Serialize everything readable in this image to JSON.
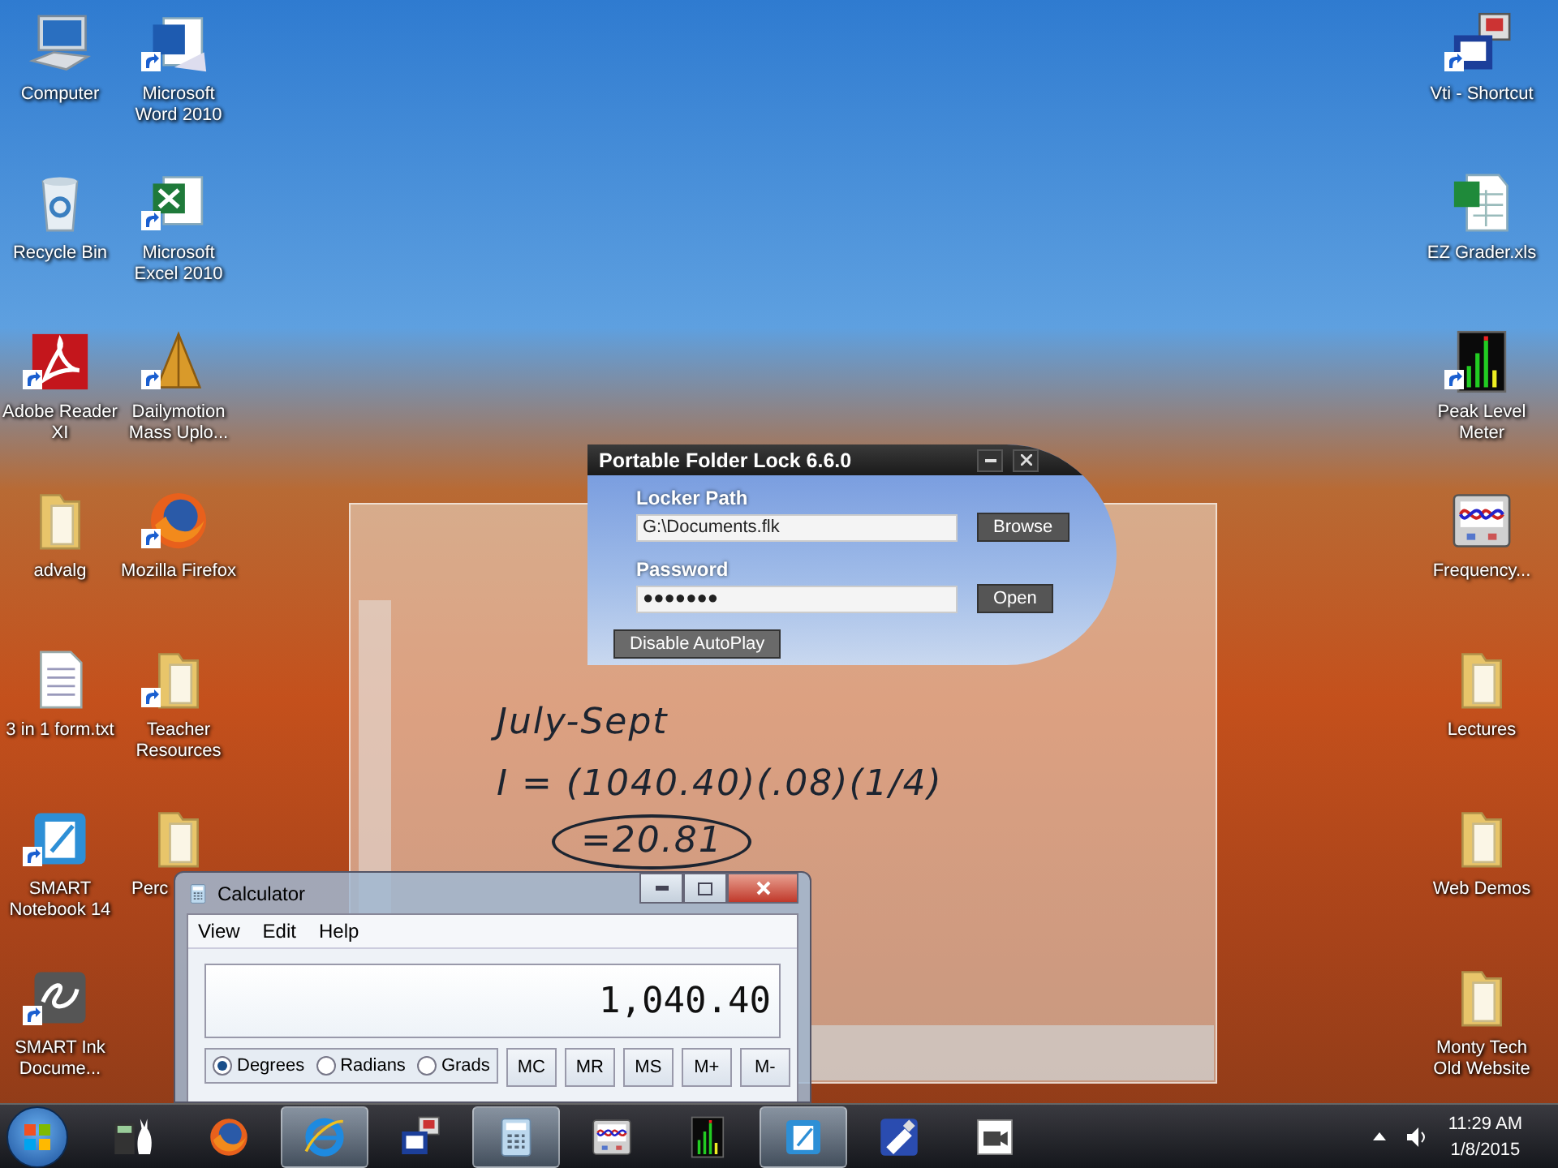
{
  "desktop": {
    "left_columns": [
      [
        {
          "label": "Computer",
          "kind": "computer",
          "shortcut": false,
          "clipped": false
        },
        {
          "label": "Recycle Bin",
          "kind": "recycle",
          "shortcut": false,
          "clipped": false
        },
        {
          "label": "Adobe Reader XI",
          "kind": "pdf",
          "shortcut": true,
          "clipped": false
        },
        {
          "label": "advalg",
          "kind": "folder",
          "shortcut": false,
          "clipped": false
        },
        {
          "label": "3 in 1 form.txt",
          "kind": "textfile",
          "shortcut": false,
          "clipped": false
        },
        {
          "label": "SMART Notebook 14",
          "kind": "smart",
          "shortcut": true,
          "clipped": false
        },
        {
          "label": "SMART Ink Docume...",
          "kind": "ink",
          "shortcut": true,
          "clipped": false
        }
      ],
      [
        {
          "label": "Microsoft Word 2010",
          "kind": "word",
          "shortcut": true,
          "clipped": false
        },
        {
          "label": "Microsoft Excel 2010",
          "kind": "excel",
          "shortcut": true,
          "clipped": false
        },
        {
          "label": "Dailymotion Mass Uplo...",
          "kind": "cone",
          "shortcut": true,
          "clipped": false
        },
        {
          "label": "Mozilla Firefox",
          "kind": "firefox",
          "shortcut": true,
          "clipped": false
        },
        {
          "label": "Teacher Resources",
          "kind": "folder",
          "shortcut": true,
          "clipped": false
        },
        {
          "label": "Perc",
          "kind": "folder",
          "shortcut": false,
          "clipped": true
        }
      ]
    ],
    "right_column": [
      {
        "label": "Vti - Shortcut",
        "kind": "vti",
        "shortcut": true,
        "clipped": false
      },
      {
        "label": "EZ Grader.xls",
        "kind": "sheet",
        "shortcut": false,
        "clipped": false
      },
      {
        "label": "Peak Level Meter",
        "kind": "meter",
        "shortcut": true,
        "clipped": false
      },
      {
        "label": "Frequency...",
        "kind": "wave",
        "shortcut": false,
        "clipped": false
      },
      {
        "label": "Lectures",
        "kind": "folder",
        "shortcut": false,
        "clipped": false
      },
      {
        "label": "Web Demos",
        "kind": "folder",
        "shortcut": false,
        "clipped": false
      },
      {
        "label": "Monty Tech Old Website",
        "kind": "folder",
        "shortcut": false,
        "clipped": false
      }
    ]
  },
  "notebook": {
    "lines": [
      {
        "text": "July-Sept",
        "circled": false
      },
      {
        "text": "I = (1040.40)(.08)(1/4)",
        "circled": false
      },
      {
        "text": "=20.81",
        "circled": true
      }
    ]
  },
  "folder_lock": {
    "title": "Portable Folder Lock 6.6.0",
    "path_label": "Locker Path",
    "path_value": "G:\\Documents.flk",
    "browse": "Browse",
    "password_label": "Password",
    "password_mask": "●●●●●●●",
    "open": "Open",
    "autoplay": "Disable AutoPlay"
  },
  "calculator": {
    "title": "Calculator",
    "menu": [
      "View",
      "Edit",
      "Help"
    ],
    "display": "1,040.40",
    "angle_units": [
      {
        "label": "Degrees",
        "selected": true
      },
      {
        "label": "Radians",
        "selected": false
      },
      {
        "label": "Grads",
        "selected": false
      }
    ],
    "memory_buttons": [
      "MC",
      "MR",
      "MS",
      "M+",
      "M-"
    ]
  },
  "taskbar": {
    "items": [
      {
        "kind": "calcrabbit",
        "running": false
      },
      {
        "kind": "firefox",
        "running": false
      },
      {
        "kind": "ie",
        "running": true
      },
      {
        "kind": "vti",
        "running": false
      },
      {
        "kind": "calculator",
        "running": true
      },
      {
        "kind": "wave",
        "running": false
      },
      {
        "kind": "meter",
        "running": false
      },
      {
        "kind": "smart",
        "running": true
      },
      {
        "kind": "usb",
        "running": false
      },
      {
        "kind": "camera",
        "running": false
      }
    ],
    "time": "11:29 AM",
    "date": "1/8/2015"
  }
}
